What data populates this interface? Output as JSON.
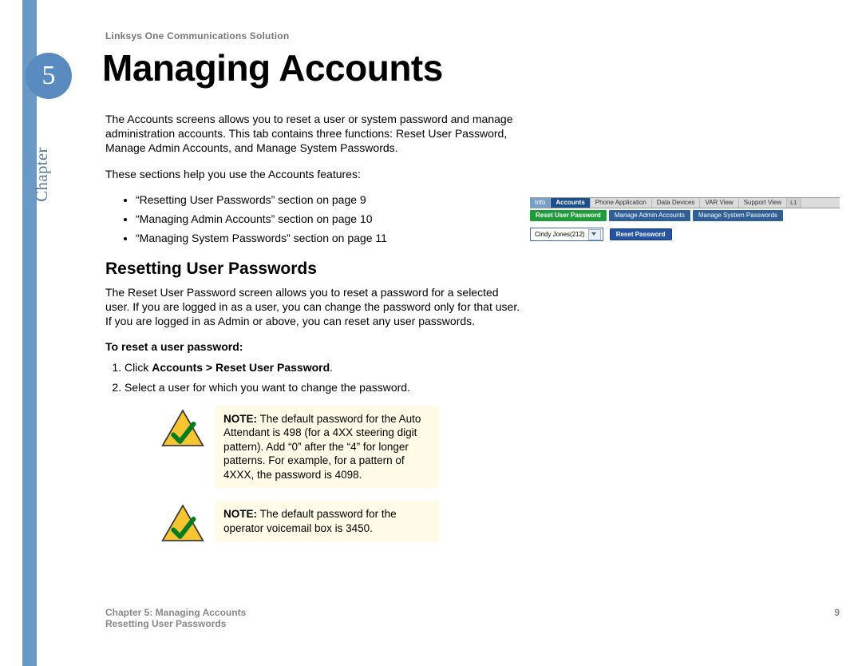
{
  "header": {
    "product_line": "Linksys One Communications Solution",
    "chapter_side_label": "Chapter",
    "chapter_number": "5",
    "page_title": "Managing Accounts"
  },
  "content": {
    "intro": "The Accounts screens allows you to reset a user or system password and manage administration accounts. This tab contains three functions: Reset User Password, Manage Admin Accounts, and Manage System Passwords.",
    "lead_in": "These sections help you use the Accounts features:",
    "bullets": [
      "“Resetting User Passwords” section on page 9",
      "“Managing Admin Accounts” section on page 10",
      "“Managing System Passwords” section on page 11"
    ],
    "section_heading": "Resetting User Passwords",
    "section_body": "The Reset User Password screen allows you to reset a password for a selected user. If you are logged in as a user, you can change the password only for that user. If you are logged in as Admin or above, you can reset any user passwords.",
    "steps_heading": "To reset a user password:",
    "step1_prefix": "Click ",
    "step1_bold": "Accounts > Reset User Password",
    "step1_suffix": ".",
    "step2": "Select a user for which you want to change the password.",
    "note1_label": "NOTE:",
    "note1_body": " The default password for the Auto Attendant is 498 (for a 4XX steering digit pattern). Add “0” after the “4” for longer patterns. For example, for a pattern of 4XXX, the password is 4098.",
    "note2_label": "NOTE:",
    "note2_body": " The default password for the operator voicemail box is 3450."
  },
  "ui_shot": {
    "tabs": [
      "Info",
      "Accounts",
      "Phone Application",
      "Data Devices",
      "VAR View",
      "Support View"
    ],
    "lock_tab": "L1",
    "active_tab_index": 1,
    "subtabs": [
      "Reset User Password",
      "Manage Admin Accounts",
      "Manage System Passwords"
    ],
    "active_subtab_index": 0,
    "select_value": "Cindy Jones(212)",
    "button_label": "Reset Password"
  },
  "footer": {
    "line1": "Chapter 5: Managing Accounts",
    "line2": "Resetting User Passwords",
    "page_number": "9"
  }
}
